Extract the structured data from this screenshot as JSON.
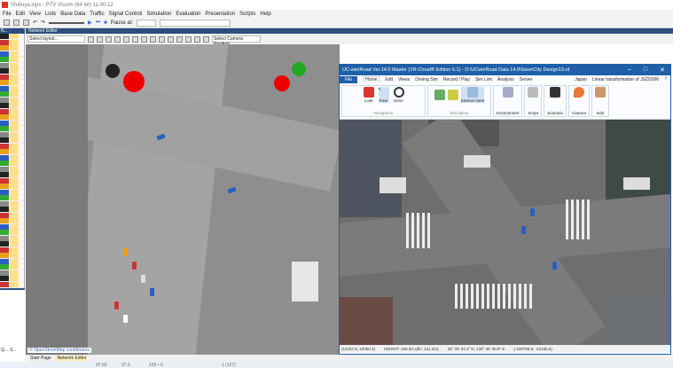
{
  "vissim": {
    "title": "Shibuya.inpx - PTV Vissim (64 bit) 11.00-12",
    "menu": [
      "File",
      "Edit",
      "View",
      "Lists",
      "Base Data",
      "Traffic",
      "Signal Control",
      "Simulation",
      "Evaluation",
      "Presentation",
      "Scripts",
      "Help"
    ],
    "pause_label": "Pause at:",
    "left_panel_title": "N...",
    "network_editor_title": "Network Editor",
    "select_layout": "Select layout...",
    "select_camera": "Select Camera Position",
    "osm_credit": "© OpenStreetMap contributors",
    "tabs": [
      "Start Page",
      "Network Editor"
    ],
    "lower_tabs": [
      "Q...",
      "S..."
    ],
    "status": [
      "97.60",
      "97.0",
      "120 • 0",
      "1 (127)"
    ]
  },
  "ucwin": {
    "title": "UC-win/Road Ver.14.0 Master (VR-Cloud® Edition 6.1) - D:\\UCwinRoad Data 14.0\\Save\\City Design13.rd",
    "menu": [
      "File",
      "Home",
      "Edit",
      "Views",
      "Driving Sim",
      "Record / Play",
      "Sim Link",
      "Analysis",
      "Server"
    ],
    "region": "Japan",
    "transform": "Linear transformation of JGD2000",
    "nav_buttons": [
      "Look",
      "Free",
      "Drive"
    ],
    "nav_group": "Navigation",
    "sim_group": "Simulation",
    "environment_btn": "Environ ment",
    "groups": [
      "Environment",
      "Script",
      "Scenario",
      "Camera",
      "Edit"
    ],
    "status": [
      "(12157.6, 10050.4)",
      "HEIGHT: 160.3m (dH: 121.3m)",
      "35° 00' 34.2\" N, 139° 45' 30.8\" E",
      "(-109708.8, -22165.6)"
    ]
  },
  "colors": {
    "vissim_header": "#2c4f7c",
    "ucwin_blue": "#1e5fa8"
  }
}
